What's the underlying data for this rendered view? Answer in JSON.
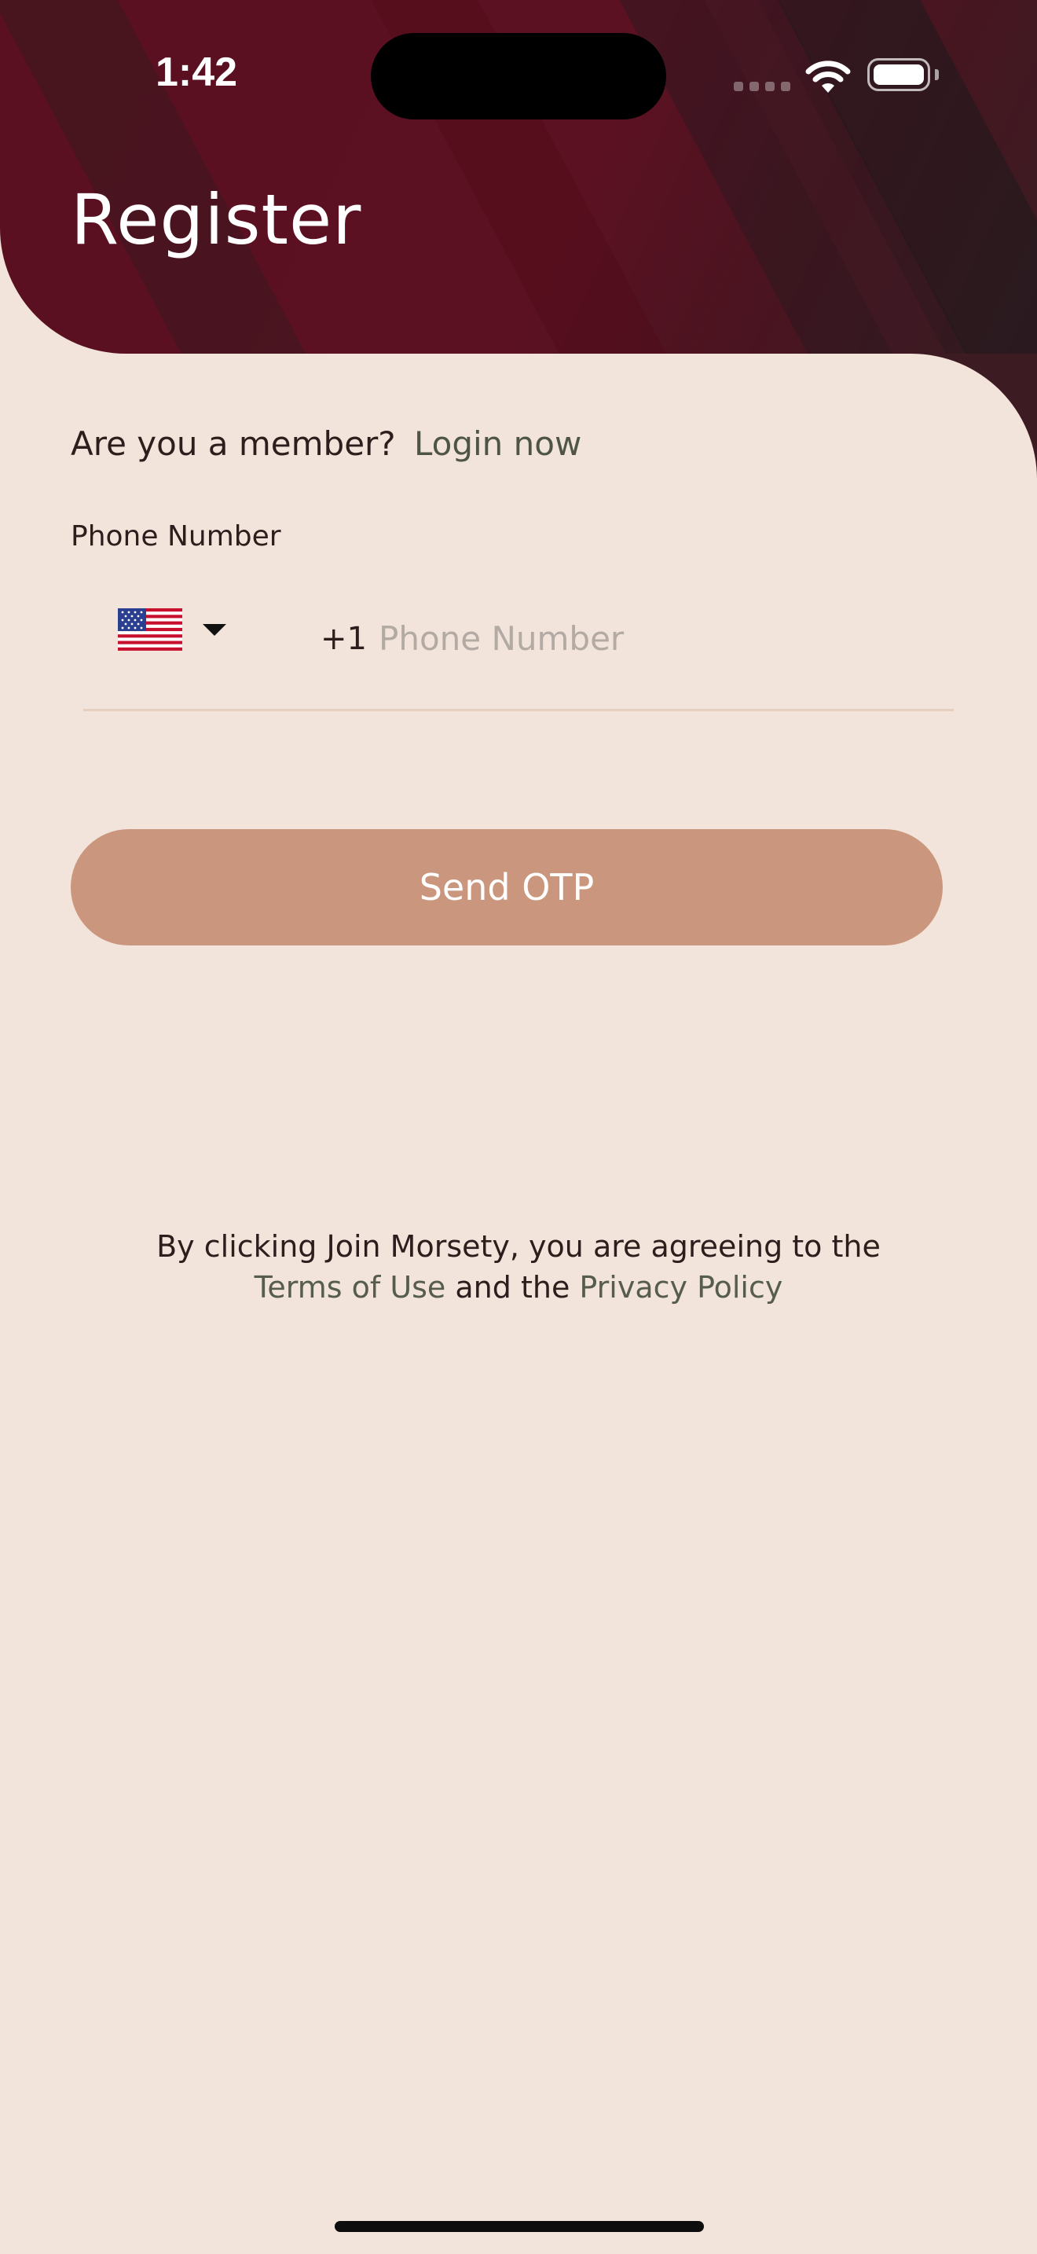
{
  "status_bar": {
    "time": "1:42"
  },
  "header": {
    "title": "Register",
    "background_color": "#5a1020"
  },
  "member_prompt": {
    "question": "Are you a member?",
    "login_link": "Login now"
  },
  "phone": {
    "label": "Phone Number",
    "country_flag": "us-flag",
    "dial_code": "+1",
    "placeholder": "Phone Number",
    "value": ""
  },
  "otp_button": {
    "label": "Send OTP",
    "color": "#ca977e"
  },
  "terms": {
    "prefix": "By clicking Join Morsety, you are agreeing to the ",
    "terms_link": "Terms of Use",
    "middle": " and the ",
    "privacy_link": "Privacy Policy"
  }
}
